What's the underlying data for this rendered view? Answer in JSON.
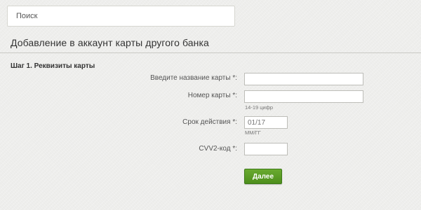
{
  "search": {
    "placeholder": "Поиск",
    "value": ""
  },
  "page": {
    "title": "Добавление в аккаунт карты другого банка"
  },
  "form": {
    "step_title": "Шаг 1. Реквизиты карты",
    "fields": [
      {
        "label": "Введите название карты *:",
        "value": "",
        "hint": ""
      },
      {
        "label": "Номер карты *:",
        "value": "",
        "hint": "14-19 цифр"
      },
      {
        "label": "Срок действия *:",
        "value": "",
        "placeholder": "01/17",
        "hint": "ММ/ГГ"
      },
      {
        "label": "CVV2-код *:",
        "value": "",
        "hint": ""
      }
    ],
    "next_label": "Далее"
  },
  "colors": {
    "background": "#eeeeec",
    "button_green": "#5a9c25",
    "text": "#333333"
  }
}
